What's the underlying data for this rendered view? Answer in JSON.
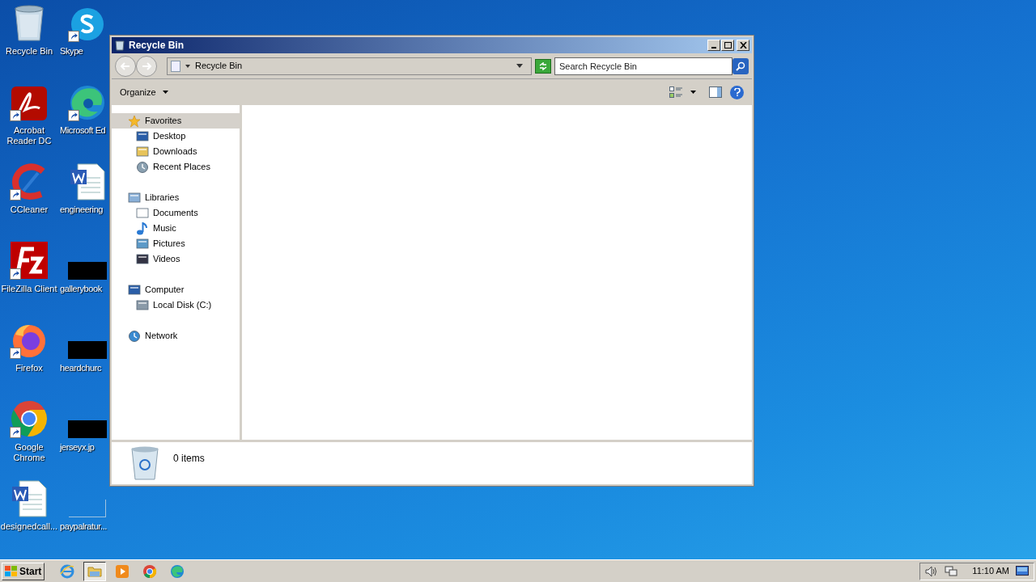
{
  "desktop_columns": [
    [
      {
        "label": "Recycle Bin",
        "kind": "recycle",
        "shortcut": false
      },
      {
        "label": "Acrobat Reader DC",
        "kind": "acrobat",
        "shortcut": true
      },
      {
        "label": "CCleaner",
        "kind": "ccleaner",
        "shortcut": true
      },
      {
        "label": "FileZilla Client",
        "kind": "filezilla",
        "shortcut": true
      },
      {
        "label": "Firefox",
        "kind": "firefox",
        "shortcut": true
      },
      {
        "label": "Google Chrome",
        "kind": "chrome",
        "shortcut": true
      },
      {
        "label": "designedcall...",
        "kind": "word",
        "shortcut": false
      }
    ],
    [
      {
        "label": "Skype",
        "kind": "skype",
        "shortcut": true
      },
      {
        "label": "Microsoft Ed",
        "kind": "edge",
        "shortcut": true
      },
      {
        "label": "engineering",
        "kind": "word",
        "shortcut": false
      },
      {
        "label": "gallerybook",
        "kind": "redacted",
        "shortcut": false
      },
      {
        "label": "heardchurc",
        "kind": "redacted",
        "shortcut": false
      },
      {
        "label": "jerseyx.jp",
        "kind": "redacted",
        "shortcut": false
      },
      {
        "label": "paypalratur...",
        "kind": "blank",
        "shortcut": false
      }
    ]
  ],
  "window": {
    "title": "Recycle Bin",
    "address": "Recycle Bin",
    "search": {
      "placeholder": "Search Recycle Bin"
    },
    "toolbar": {
      "organize": "Organize"
    },
    "sidebar": [
      {
        "label": "Favorites",
        "kind": "star",
        "selected": true,
        "children": [
          {
            "label": "Desktop",
            "kind": "desktop",
            "selected": false
          },
          {
            "label": "Downloads",
            "kind": "downloads",
            "selected": false
          },
          {
            "label": "Recent Places",
            "kind": "recent",
            "selected": false
          }
        ]
      },
      {
        "label": "Libraries",
        "kind": "libraries",
        "selected": false,
        "children": [
          {
            "label": "Documents",
            "kind": "documents",
            "selected": false
          },
          {
            "label": "Music",
            "kind": "music",
            "selected": false
          },
          {
            "label": "Pictures",
            "kind": "pictures",
            "selected": false
          },
          {
            "label": "Videos",
            "kind": "videos",
            "selected": false
          }
        ]
      },
      {
        "label": "Computer",
        "kind": "computer",
        "selected": false,
        "children": [
          {
            "label": "Local Disk (C:)",
            "kind": "disk",
            "selected": false
          }
        ]
      },
      {
        "label": "Network",
        "kind": "network",
        "selected": false
      }
    ],
    "status": "0 items"
  },
  "taskbar": {
    "start": "Start",
    "pinned": [
      {
        "kind": "ie",
        "selected": false
      },
      {
        "kind": "explorer",
        "selected": true
      },
      {
        "kind": "media",
        "selected": false
      },
      {
        "kind": "chrome",
        "selected": false
      },
      {
        "kind": "edge",
        "selected": false
      }
    ],
    "clock": "11:10 AM"
  }
}
